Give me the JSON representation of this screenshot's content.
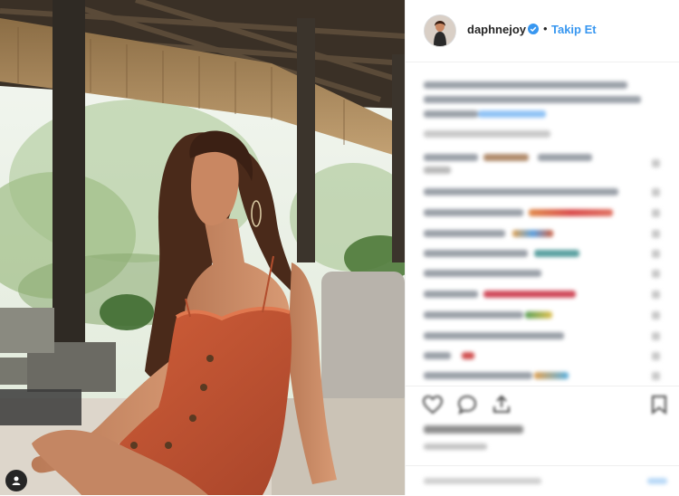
{
  "header": {
    "username": "daphnejoy",
    "separator": "•",
    "follow_label": "Takip Et"
  },
  "colors": {
    "follow_blue": "#3897f0",
    "verified_blue": "#3897f0",
    "dress_orange": "#cc5a35"
  },
  "icons": [
    "verified-badge-icon",
    "heart-icon",
    "comment-icon",
    "share-icon",
    "bookmark-icon",
    "user-tag-icon"
  ]
}
